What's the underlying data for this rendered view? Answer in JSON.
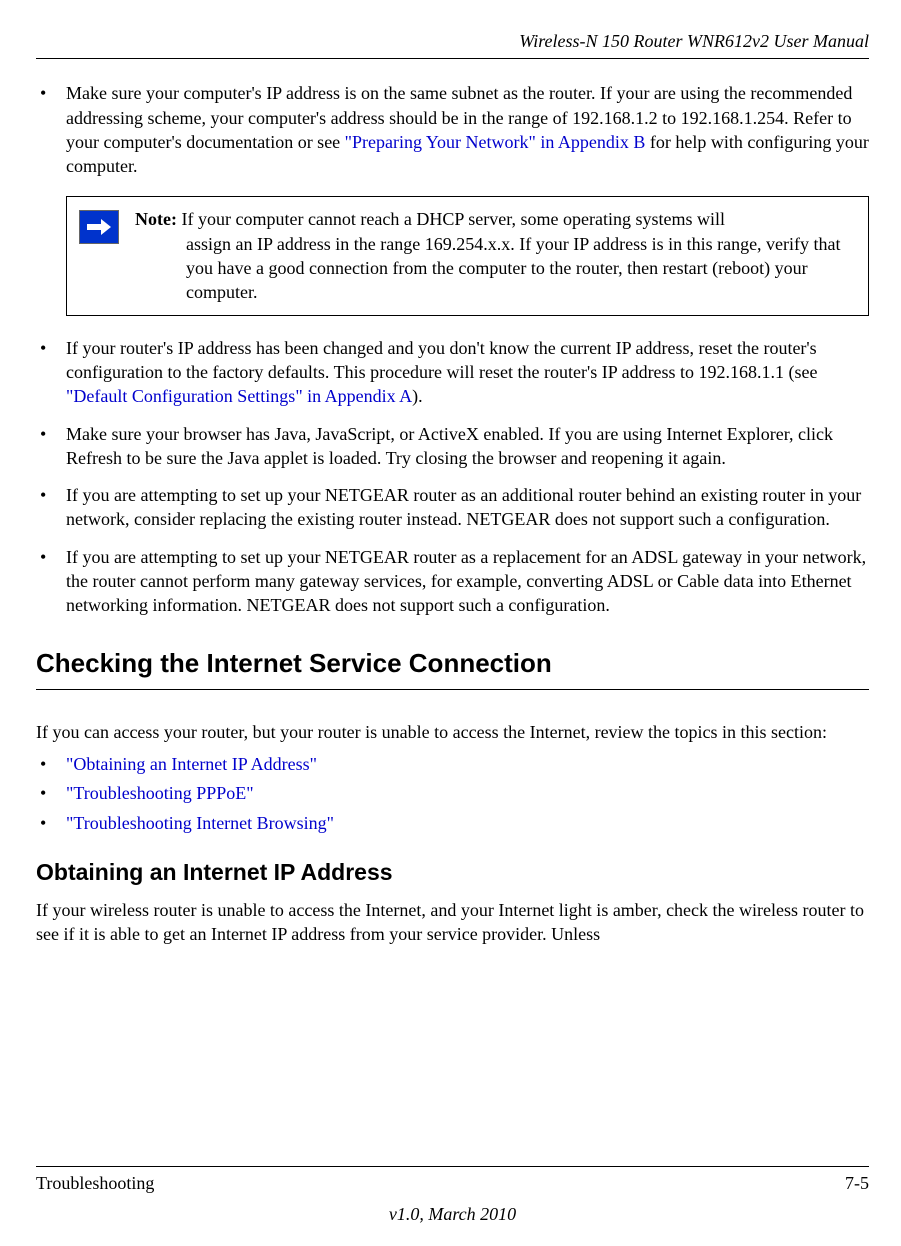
{
  "header": {
    "title": "Wireless-N 150 Router WNR612v2 User Manual"
  },
  "bullets": {
    "b1_pre": "Make sure your computer's IP address is on the same subnet as the router. If your are using the recommended addressing scheme, your computer's address should be in the range of 192.168.1.2 to 192.168.1.254. Refer to your computer's documentation or see ",
    "b1_link": "\"Preparing Your Network\" in Appendix B",
    "b1_post": " for help with configuring your computer.",
    "b2_pre": "If your router's IP address has been changed and you don't know the current IP address, reset the router's configuration to the factory defaults. This procedure will reset the router's IP address to 192.168.1.1 (see ",
    "b2_link": "\"Default Configuration Settings\" in Appendix A",
    "b2_post": ").",
    "b3": "Make sure your browser has Java, JavaScript, or ActiveX enabled. If you are using Internet Explorer, click Refresh to be sure the Java applet is loaded. Try closing the browser and reopening it again.",
    "b4": "If you are attempting to set up your NETGEAR router as an additional router behind an existing router in your network, consider replacing the existing router instead. NETGEAR does not support such a configuration.",
    "b5": "If you are attempting to set up your NETGEAR router as a replacement for an ADSL gateway in your network, the router cannot perform many gateway services, for example, converting ADSL or Cable data into Ethernet networking information. NETGEAR does not support such a configuration."
  },
  "note": {
    "label": "Note: ",
    "body": "If your computer cannot reach a DHCP server, some operating systems will ",
    "continuation": "assign an IP address in the range 169.254.x.x. If your IP address is in this range, verify that you have a good connection from the computer to the router, then restart (reboot) your computer."
  },
  "section": {
    "heading": "Checking the Internet Service Connection",
    "intro": "If you can access your router, but your router is unable to access the Internet, review the topics in this section:",
    "links": {
      "l1": "\"Obtaining an Internet IP Address\"",
      "l2": "\"Troubleshooting PPPoE\"",
      "l3": "\"Troubleshooting Internet Browsing\""
    }
  },
  "subsection": {
    "heading": "Obtaining an Internet IP Address",
    "para": "If your wireless router is unable to access the Internet, and your Internet light is amber, check the wireless router to see if it is able to get an Internet IP address from your service provider. Unless"
  },
  "footer": {
    "left": "Troubleshooting",
    "right": "7-5",
    "version": "v1.0, March 2010"
  },
  "bullet_char": "•"
}
